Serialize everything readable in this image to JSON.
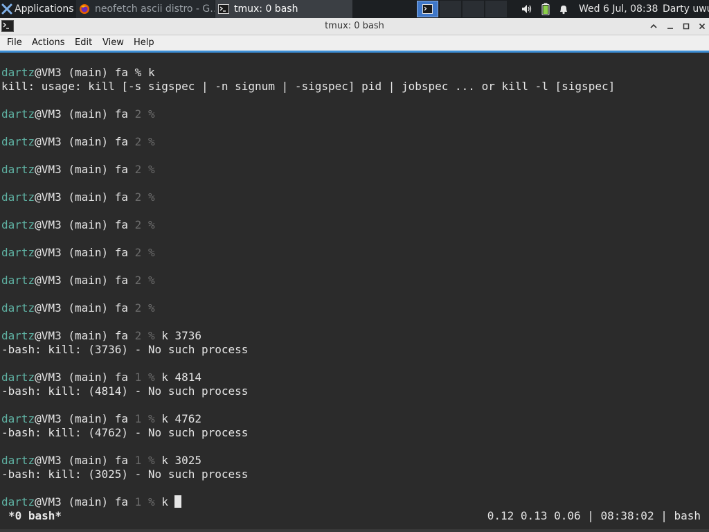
{
  "panel": {
    "applications_label": "Applications",
    "tasks": [
      {
        "label": "neofetch ascii distro - G…",
        "icon": "firefox-icon"
      },
      {
        "label": "tmux: 0 bash",
        "icon": "terminal-icon"
      }
    ],
    "clock": "Wed  6 Jul, 08:38",
    "user": "Darty uwu"
  },
  "window": {
    "title": "tmux: 0 bash",
    "menu": [
      "File",
      "Actions",
      "Edit",
      "View",
      "Help"
    ]
  },
  "terminal": {
    "prompt_user": "dartz",
    "prompt_host": "@VM3 (main) fa ",
    "lines": [
      {
        "kind": "prompt",
        "status": "%",
        "status_dim": false,
        "cmd": " k"
      },
      {
        "kind": "out",
        "text": "kill: usage: kill [-s sigspec | -n signum | -sigspec] pid | jobspec ... or kill -l [sigspec]"
      },
      {
        "kind": "prompt",
        "status": "2 %",
        "status_dim": true,
        "cmd": ""
      },
      {
        "kind": "prompt",
        "status": "2 %",
        "status_dim": true,
        "cmd": ""
      },
      {
        "kind": "prompt",
        "status": "2 %",
        "status_dim": true,
        "cmd": ""
      },
      {
        "kind": "prompt",
        "status": "2 %",
        "status_dim": true,
        "cmd": ""
      },
      {
        "kind": "prompt",
        "status": "2 %",
        "status_dim": true,
        "cmd": ""
      },
      {
        "kind": "prompt",
        "status": "2 %",
        "status_dim": true,
        "cmd": ""
      },
      {
        "kind": "prompt",
        "status": "2 %",
        "status_dim": true,
        "cmd": ""
      },
      {
        "kind": "prompt",
        "status": "2 %",
        "status_dim": true,
        "cmd": ""
      },
      {
        "kind": "prompt",
        "status": "2 %",
        "status_dim": true,
        "cmd": " k 3736"
      },
      {
        "kind": "out",
        "text": "-bash: kill: (3736) - No such process"
      },
      {
        "kind": "prompt",
        "status": "1 %",
        "status_dim": true,
        "cmd": " k 4814"
      },
      {
        "kind": "out",
        "text": "-bash: kill: (4814) - No such process"
      },
      {
        "kind": "prompt",
        "status": "1 %",
        "status_dim": true,
        "cmd": " k 4762"
      },
      {
        "kind": "out",
        "text": "-bash: kill: (4762) - No such process"
      },
      {
        "kind": "prompt",
        "status": "1 %",
        "status_dim": true,
        "cmd": " k 3025"
      },
      {
        "kind": "out",
        "text": "-bash: kill: (3025) - No such process"
      },
      {
        "kind": "prompt",
        "status": "1 %",
        "status_dim": true,
        "cmd": " k ",
        "cursor": true
      }
    ]
  },
  "tmux_status": {
    "left": "*0 bash*",
    "right": "0.12 0.13 0.06 | 08:38:02 | bash"
  },
  "colors": {
    "prompt_user": "#5fb3a4",
    "dim": "#6b6b6b",
    "terminal_bg": "#2b2b2b",
    "accent": "#3d8fd6"
  }
}
